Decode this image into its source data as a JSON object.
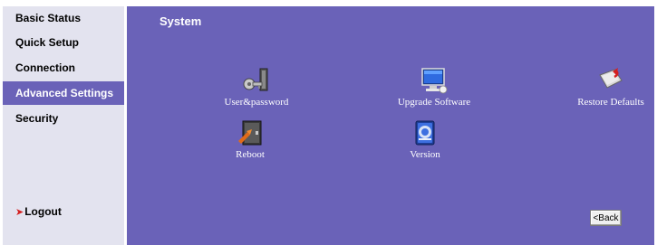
{
  "sidebar": {
    "items": [
      {
        "label": "Basic Status",
        "active": false
      },
      {
        "label": "Quick Setup",
        "active": false
      },
      {
        "label": "Connection",
        "active": false
      },
      {
        "label": "Advanced Settings",
        "active": true
      },
      {
        "label": "Security",
        "active": false
      }
    ],
    "logout_label": "Logout",
    "logout_icon": "red-arrow-icon"
  },
  "main": {
    "title": "System",
    "tiles": [
      {
        "label": "User&password",
        "icon": "key-icon"
      },
      {
        "label": "Upgrade Software",
        "icon": "monitor-icon"
      },
      {
        "label": "Restore Defaults",
        "icon": "restore-icon"
      },
      {
        "label": "Reboot",
        "icon": "reboot-icon"
      },
      {
        "label": "Version",
        "icon": "version-icon"
      }
    ],
    "back_label": "<Back"
  },
  "colors": {
    "sidebar_bg": "#e3e3ef",
    "main_bg": "#6a62b8",
    "active_bg": "#6a62b8",
    "text_light": "#ffffff",
    "logout_arrow": "#d42020"
  }
}
